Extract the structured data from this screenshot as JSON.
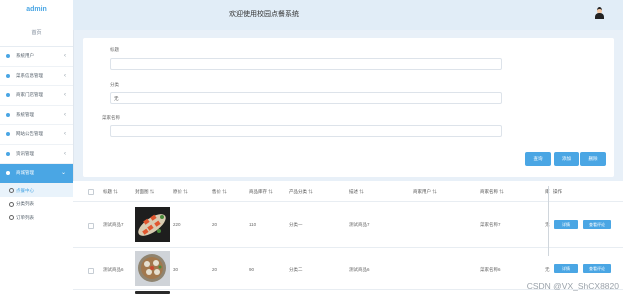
{
  "app": {
    "logo": "admin",
    "title": "欢迎使用校园点餐系统"
  },
  "sidebar": {
    "home": "首页",
    "items": [
      {
        "label": "系统用户",
        "active": false
      },
      {
        "label": "菜系信息管理",
        "active": false
      },
      {
        "label": "商家门店管理",
        "active": false
      },
      {
        "label": "系统管理",
        "active": false
      },
      {
        "label": "网站公告管理",
        "active": false
      },
      {
        "label": "资讯管理",
        "active": false
      },
      {
        "label": "商城管理",
        "active": true
      }
    ],
    "subitems": [
      {
        "label": "点餐中心",
        "selected": true
      },
      {
        "label": "分类列表",
        "selected": false
      },
      {
        "label": "订单列表",
        "selected": false
      }
    ]
  },
  "search": {
    "fields": [
      {
        "label": "标题",
        "value": ""
      },
      {
        "label": "分类",
        "value": "无"
      },
      {
        "label": "菜家名称",
        "value": ""
      }
    ],
    "buttons": {
      "query": "查询",
      "add": "添加",
      "delete": "删除"
    }
  },
  "table": {
    "columns": [
      "标题",
      "封面图",
      "原价",
      "售价",
      "商品库存",
      "产品分类",
      "描述",
      "商家用户",
      "商家名称",
      "库",
      "操作"
    ],
    "rows": [
      {
        "title": "测试商品7",
        "price_orig": "220",
        "price": "20",
        "stock": "110",
        "category": "分类一",
        "desc": "测试商品7",
        "user": "",
        "shop": "菜家名称7",
        "kc": "无",
        "detail": "详情",
        "review": "查看评论"
      },
      {
        "title": "测试商品6",
        "price_orig": "30",
        "price": "20",
        "stock": "90",
        "category": "分类二",
        "desc": "测试商品6",
        "user": "",
        "shop": "菜家名称6",
        "kc": "无",
        "detail": "详情",
        "review": "查看评论"
      }
    ]
  },
  "watermark": "CSDN @VX_ShCX8820",
  "colors": {
    "accent": "#4aa6e4",
    "background": "#e8f0f8"
  }
}
